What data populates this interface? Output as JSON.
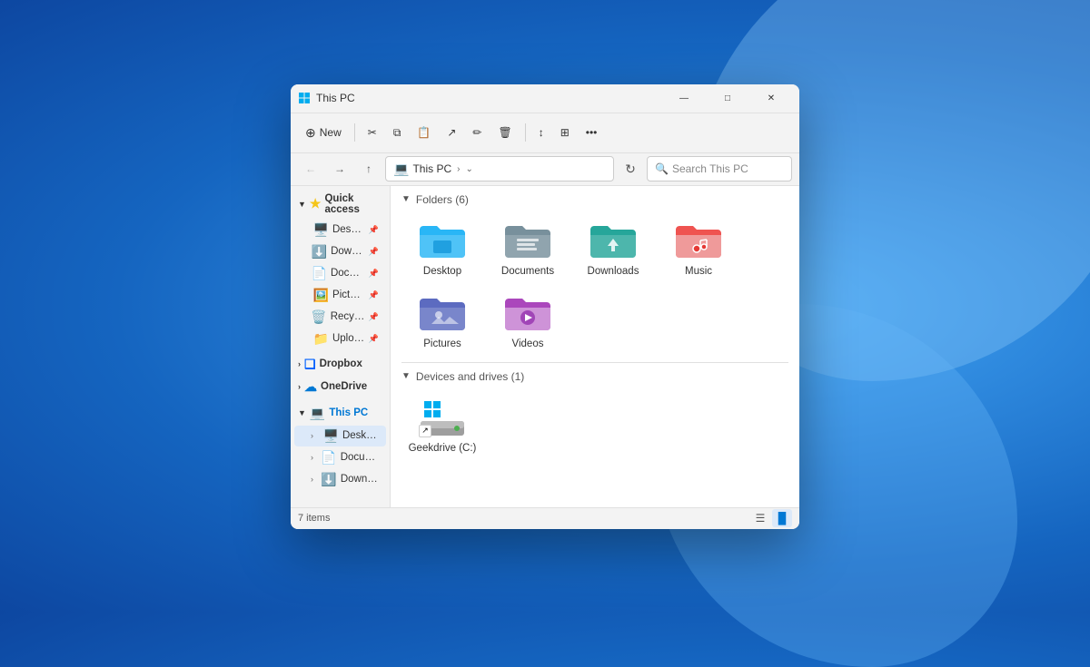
{
  "window": {
    "title": "This PC",
    "title_icon": "💻"
  },
  "toolbar": {
    "new_label": "New",
    "items_count": "7 items"
  },
  "address": {
    "location": "This PC",
    "search_placeholder": "Search This PC"
  },
  "sidebar": {
    "quick_access_label": "Quick access",
    "items": [
      {
        "label": "Desktop",
        "icon": "🖥️",
        "pinned": true
      },
      {
        "label": "Downloads",
        "icon": "⬇️",
        "pinned": true
      },
      {
        "label": "Documents",
        "icon": "📄",
        "pinned": true
      },
      {
        "label": "Pictures",
        "icon": "🖼️",
        "pinned": true
      },
      {
        "label": "Recycle Bin",
        "icon": "🗑️",
        "pinned": true
      },
      {
        "label": "Uploads",
        "icon": "📁",
        "pinned": true
      }
    ],
    "dropbox_label": "Dropbox",
    "onedrive_label": "OneDrive",
    "this_pc_label": "This PC",
    "this_pc_items": [
      {
        "label": "Desktop",
        "icon": "🖥️"
      },
      {
        "label": "Documents",
        "icon": "📄"
      },
      {
        "label": "Downloads",
        "icon": "⬇️"
      }
    ]
  },
  "content": {
    "folders_header": "Folders (6)",
    "folders": [
      {
        "label": "Desktop",
        "color": "#2196f3"
      },
      {
        "label": "Documents",
        "color": "#607d8b"
      },
      {
        "label": "Downloads",
        "color": "#4caf50"
      },
      {
        "label": "Music",
        "color": "#f44336"
      },
      {
        "label": "Pictures",
        "color": "#3f51b5"
      },
      {
        "label": "Videos",
        "color": "#9c27b0"
      }
    ],
    "drives_header": "Devices and drives (1)",
    "drives": [
      {
        "label": "Geekdrive (C:)"
      }
    ]
  },
  "status": {
    "items_count": "7 items"
  },
  "colors": {
    "desktop_folder": "#29b6f6",
    "documents_folder": "#78909c",
    "downloads_folder": "#26a69a",
    "music_folder": "#ef5350",
    "pictures_folder": "#5c6bc0",
    "videos_folder": "#ab47bc",
    "accent": "#0078d4"
  }
}
